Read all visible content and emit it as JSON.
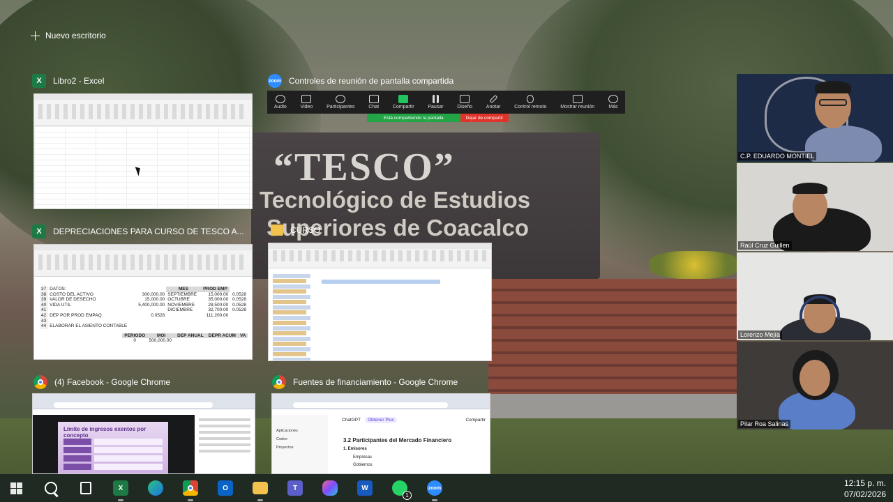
{
  "task_view": {
    "new_desktop_label": "Nuevo escritorio"
  },
  "windows": [
    {
      "title": "Libro2 - Excel",
      "icon": "excel-icon"
    },
    {
      "title": "Controles de reunión de pantalla compartida",
      "icon": "zoom-icon"
    },
    {
      "title": "DEPRECIACIONES PARA CURSO DE TESCO A...",
      "icon": "excel-icon"
    },
    {
      "title": "CURSO",
      "icon": "folder-icon"
    },
    {
      "title": "(4) Facebook - Google Chrome",
      "icon": "chrome-icon"
    },
    {
      "title": "Fuentes de financiamiento - Google Chrome",
      "icon": "chrome-icon"
    }
  ],
  "excel_sheet": {
    "rows": [
      {
        "n": "37",
        "a": "DATOS:",
        "c": "",
        "e": "MES",
        "g": "PROD EMP",
        "h": ""
      },
      {
        "n": "38",
        "a": "COSTO DEL ACTIVO",
        "c": "300,000.00",
        "e": "SEPTIEMBRE",
        "g": "15,000.00",
        "h": "0.0528"
      },
      {
        "n": "39",
        "a": "VALOR DE DESECHO",
        "c": "15,000.00",
        "e": "OCTUBRE",
        "g": "35,000.00",
        "h": "0.0528"
      },
      {
        "n": "40",
        "a": "VIDA UTIL",
        "c": "5,400,000.00",
        "e": "NOVIEMBRE",
        "g": "28,500.00",
        "h": "0.0528"
      },
      {
        "n": "41",
        "a": "",
        "c": "",
        "e": "DICIEMBRE",
        "g": "32,700.00",
        "h": "0.0528"
      },
      {
        "n": "42",
        "a": "DEP POR PROD EMPAQ",
        "c": "0.0528",
        "e": "",
        "g": "111,200.00",
        "h": ""
      },
      {
        "n": "43",
        "a": "",
        "c": "",
        "e": "",
        "g": "",
        "h": ""
      },
      {
        "n": "44",
        "a": "ELABORAR EL ASIENTO CONTABLE",
        "c": "",
        "e": "",
        "g": "",
        "h": ""
      }
    ],
    "table_headers": [
      "PERIODO",
      "MOI",
      "DEP ANUAL",
      "DEPR ACUM",
      "VA"
    ],
    "table_row": {
      "periodo": "0",
      "moi": "500,000.00"
    }
  },
  "facebook_thumb": {
    "card_title": "Límite de ingresos exentos por concepto"
  },
  "chatgpt_thumb": {
    "app_name": "ChatGPT",
    "upgrade_pill": "Obtener Plus",
    "share_label": "Compartir",
    "sidebar": [
      "Aplicaciones",
      "Codex",
      "Proyectos"
    ],
    "heading": "3.2 Participantes del Mercado Financiero",
    "item1": "1.  Emisores",
    "item2": "Empresas",
    "item3": "Gobiernos"
  },
  "zoom_controls": {
    "buttons": [
      {
        "label": "Audio",
        "icon": "microphone-icon"
      },
      {
        "label": "Video",
        "icon": "camera-icon"
      },
      {
        "label": "Participantes",
        "icon": "participants-icon"
      },
      {
        "label": "Chat",
        "icon": "chat-icon"
      },
      {
        "label": "Compartir",
        "icon": "share-icon"
      },
      {
        "label": "Pausar",
        "icon": "pause-icon"
      },
      {
        "label": "Diseño",
        "icon": "layout-icon"
      },
      {
        "label": "Anotar",
        "icon": "pencil-icon"
      },
      {
        "label": "Control remoto",
        "icon": "remote-control-icon"
      },
      {
        "label": "Mostrar reunión",
        "icon": "show-meeting-icon"
      },
      {
        "label": "Más",
        "icon": "more-icon"
      }
    ],
    "sharing_status": "Está compartiendo la pantalla",
    "stop_share": "Dejar de compartir"
  },
  "participants": [
    {
      "name": "C.P. EDUARDO MONTIEL"
    },
    {
      "name": "Raúl Cruz Guillen"
    },
    {
      "name": "Lorenzo Mejía"
    },
    {
      "name": "Pilar Roa Salinas"
    }
  ],
  "background_sign": {
    "line1": "“TESCO”",
    "line2": "Tecnológico de Estudios",
    "line3": "Superiores de Coacalco"
  },
  "taskbar": {
    "apps": [
      "start-icon",
      "search-icon",
      "task-view-icon",
      "excel-icon",
      "edge-icon",
      "chrome-icon",
      "outlook-icon",
      "file-explorer-icon",
      "teams-icon",
      "copilot-icon",
      "word-icon",
      "whatsapp-icon",
      "zoom-icon"
    ],
    "whatsapp_badge": "1"
  },
  "clock": {
    "time": "12:15 p. m.",
    "date": "07/02/2026"
  }
}
